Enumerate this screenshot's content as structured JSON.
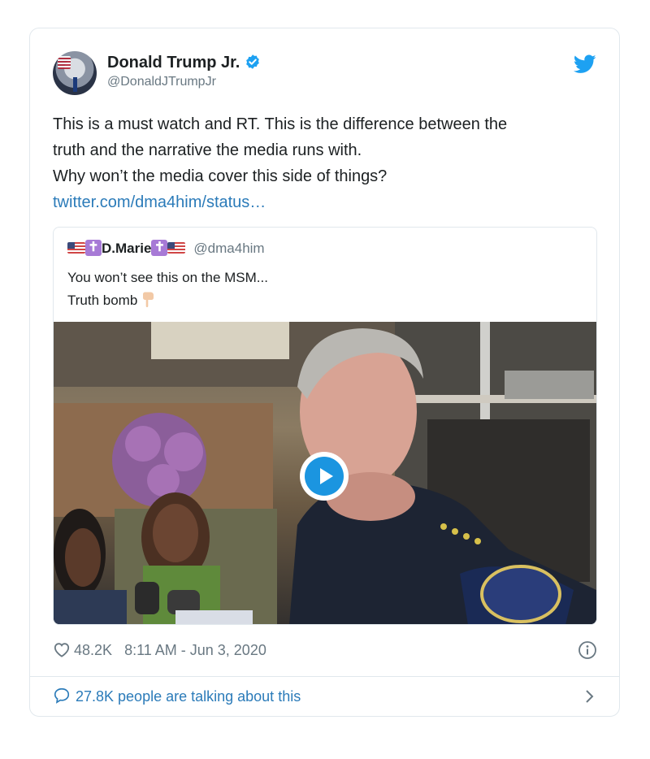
{
  "tweet": {
    "author": {
      "display_name": "Donald Trump Jr.",
      "handle": "@DonaldJTrumpJr",
      "verified_icon": "verified-badge-icon"
    },
    "text_lines": [
      "This is a must watch and RT. This is the difference between the",
      "truth and the narrative the media runs with.",
      "Why won’t the media cover this side of things?"
    ],
    "link_text": "twitter.com/dma4him/status…",
    "quoted": {
      "display_name": "D.Marie",
      "handle": "@dma4him",
      "text_lines": [
        "You won’t see this on the MSM...",
        "Truth bomb"
      ],
      "media": "video",
      "play_icon": "play-icon"
    },
    "likes": "48.2K",
    "timestamp": "8:11 AM - Jun 3, 2020",
    "talking": "27.8K people are talking about this"
  },
  "colors": {
    "accent": "#1b95e0",
    "link": "#2b7bb9",
    "muted": "#697882",
    "border": "#e1e8ed"
  }
}
